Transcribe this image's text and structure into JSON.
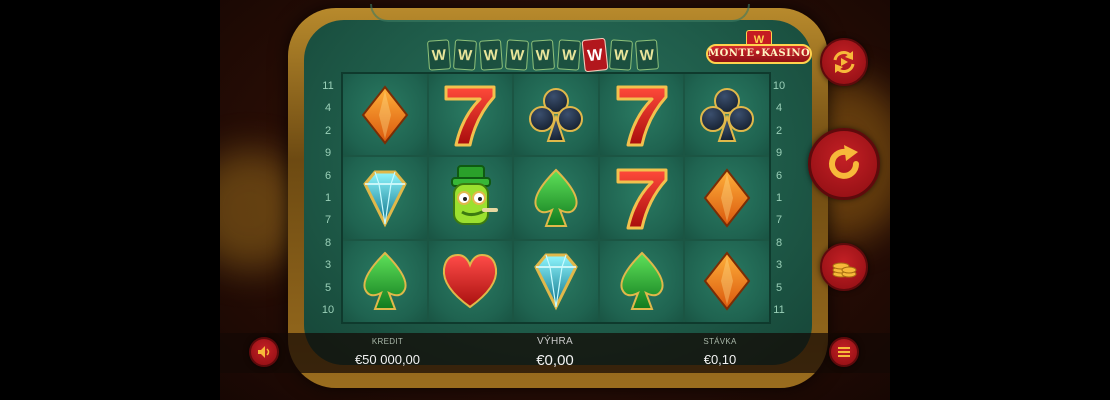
{
  "wild_meter": {
    "cards": [
      "W",
      "W",
      "W",
      "W",
      "W",
      "W",
      "W",
      "W",
      "W"
    ],
    "active_index": 6
  },
  "logo": {
    "crown": "W",
    "text": "MONTE•KASINO"
  },
  "reels": [
    [
      "diamond-suit",
      "seven",
      "club",
      "seven",
      "club"
    ],
    [
      "gem",
      "wild-character",
      "spade",
      "seven",
      "diamond-suit"
    ],
    [
      "spade",
      "heart",
      "gem",
      "spade",
      "diamond-suit"
    ]
  ],
  "paylines": {
    "left": [
      "11",
      "4",
      "2",
      "9",
      "6",
      "1",
      "7",
      "8",
      "3",
      "5",
      "10"
    ],
    "right": [
      "10",
      "4",
      "2",
      "9",
      "6",
      "1",
      "7",
      "8",
      "3",
      "5",
      "11"
    ]
  },
  "bottom": {
    "credit_label": "KREDIT",
    "credit_value": "€50 000,00",
    "win_label": "VÝHRA",
    "win_value": "€0,00",
    "bet_label": "STÁVKA",
    "bet_value": "€0,10"
  },
  "colors": {
    "button_red": "#c42025",
    "table_green": "#1f6350",
    "frame_gold": "#b88a2c"
  }
}
